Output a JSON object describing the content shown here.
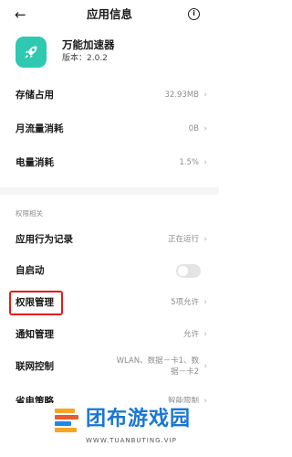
{
  "header": {
    "back_icon": "←",
    "title": "应用信息",
    "info_icon": "i"
  },
  "app": {
    "icon": "rocket-icon",
    "icon_color": "#2fc8b1",
    "name": "万能加速器",
    "version": "版本：2.0.2"
  },
  "rows": [
    {
      "label": "存储占用",
      "value": "32.93MB",
      "chevron": "›"
    },
    {
      "label": "月流量消耗",
      "value": "0B",
      "chevron": "›"
    },
    {
      "label": "电量消耗",
      "value": "1.5%",
      "chevron": "›"
    }
  ],
  "permissions_section": {
    "title": "权限相关",
    "rows": [
      {
        "label": "应用行为记录",
        "value": "正在运行",
        "chevron": "›"
      },
      {
        "label": "自启动",
        "toggle": "off"
      },
      {
        "label": "权限管理",
        "value": "5项允许",
        "chevron": "›",
        "highlighted": true,
        "highlight_color": "#e21c1c"
      },
      {
        "label": "通知管理",
        "value": "允许",
        "chevron": "›"
      },
      {
        "label": "联网控制",
        "value_line1": "WLAN、数据－卡1、数",
        "value_line2": "据－卡2",
        "chevron": "›"
      },
      {
        "label": "省电策略",
        "value": "智能限制",
        "chevron": "›"
      }
    ]
  },
  "footer": {
    "brand": "团布游戏园",
    "url": "WWW.TUANBUTING.VIP",
    "brand_color": "#1976d2"
  }
}
